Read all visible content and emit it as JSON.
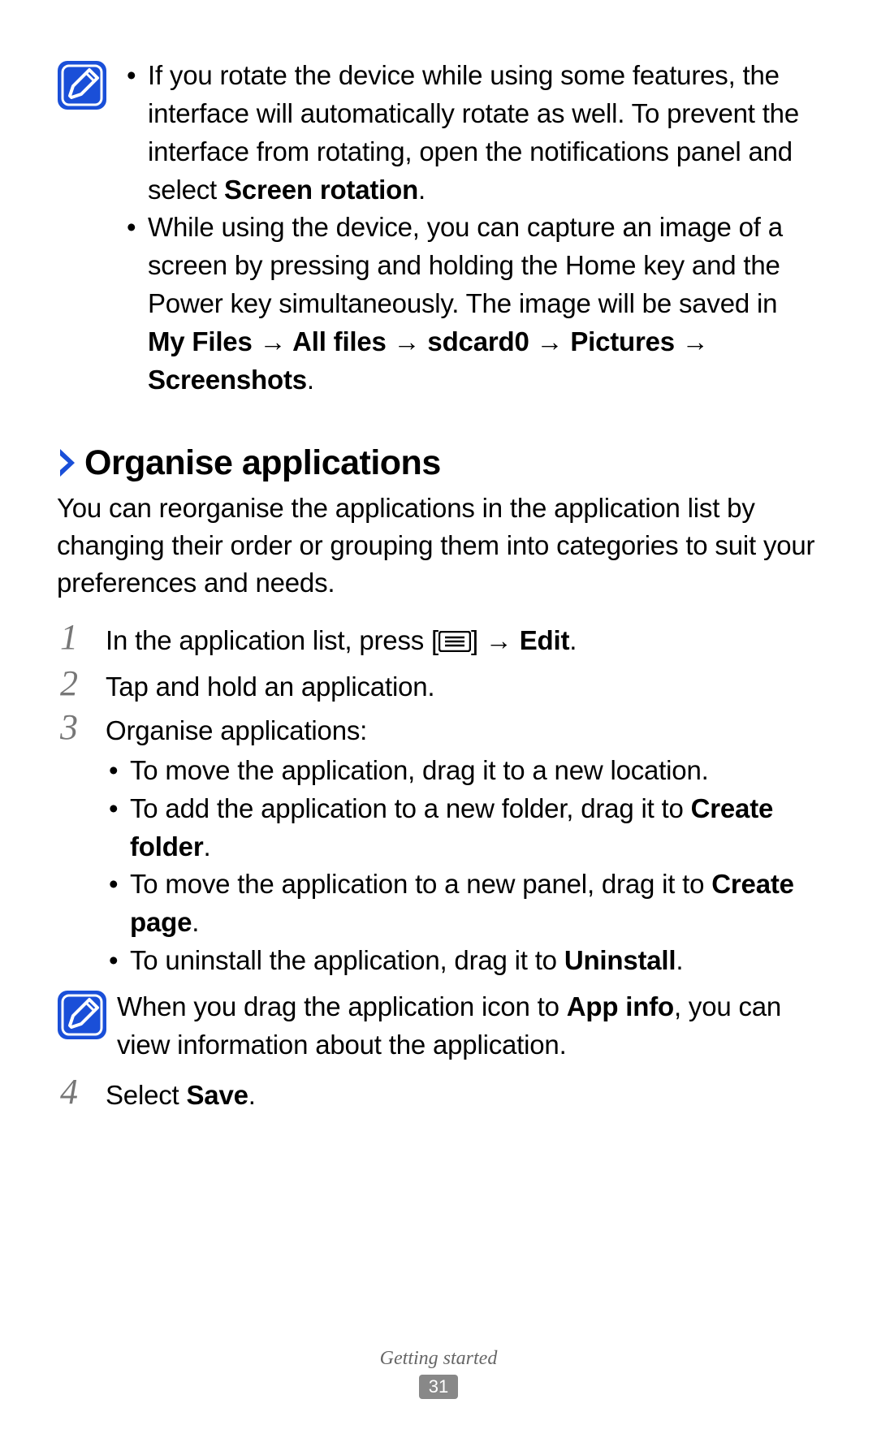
{
  "notes": {
    "top": {
      "items": [
        {
          "pre": "If you rotate the device while using some features, the interface will automatically rotate as well. To prevent the interface from rotating, open the notifications panel and select ",
          "bold1": "Screen rotation",
          "post": "."
        },
        {
          "pre": "While using the device, you can capture an image of a screen by pressing and holding the Home key and the Power key simultaneously. The image will be saved in ",
          "bold1": "My Files → All files → sdcard0 → Pictures → Screenshots",
          "post": "."
        }
      ]
    },
    "inline": {
      "pre": "When you drag the application icon to ",
      "bold1": "App info",
      "post": ", you can view information about the application."
    }
  },
  "section": {
    "heading": "Organise applications",
    "intro": "You can reorganise the applications in the application list by changing their order or grouping them into categories to suit your preferences and needs."
  },
  "steps": [
    {
      "num": "1",
      "pre": "In the application list, press [",
      "mid": "] → ",
      "bold": "Edit",
      "post": "."
    },
    {
      "num": "2",
      "text": "Tap and hold an application."
    },
    {
      "num": "3",
      "text": "Organise applications:",
      "bullets": [
        {
          "pre": "To move the application, drag it to a new location.",
          "bold": "",
          "post": ""
        },
        {
          "pre": "To add the application to a new folder, drag it to ",
          "bold": "Create folder",
          "post": "."
        },
        {
          "pre": "To move the application to a new panel, drag it to ",
          "bold": "Create page",
          "post": "."
        },
        {
          "pre": "To uninstall the application, drag it to ",
          "bold": "Uninstall",
          "post": "."
        }
      ]
    },
    {
      "num": "4",
      "pre": "Select ",
      "bold": "Save",
      "post": "."
    }
  ],
  "footer": {
    "section": "Getting started",
    "page": "31"
  }
}
